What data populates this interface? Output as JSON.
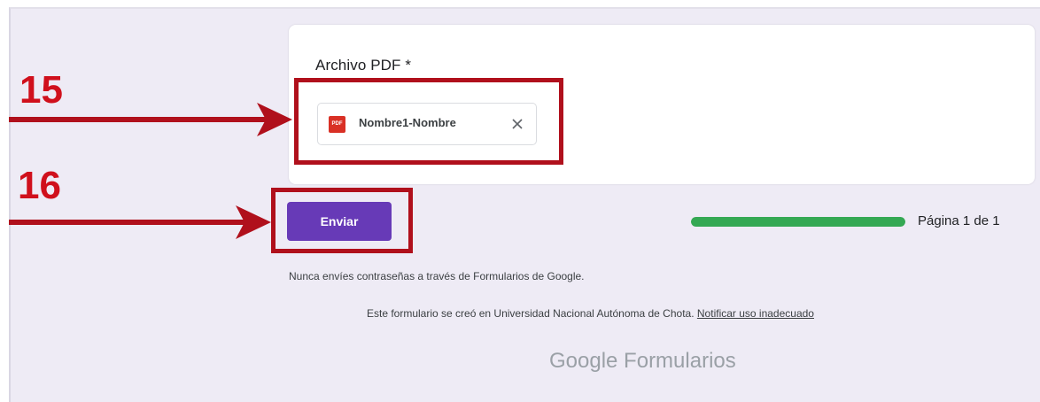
{
  "form": {
    "question_label": "Archivo PDF *",
    "file": {
      "icon_label": "PDF",
      "name": "Nombre1-Nombre",
      "remove_glyph": "✕"
    },
    "submit_label": "Enviar",
    "progress": {
      "fraction": 1.0,
      "label": "Página 1 de 1",
      "color": "#34a853"
    },
    "warning": "Nunca envíes contraseñas a través de Formularios de Google.",
    "footer": {
      "text": "Este formulario se creó en Universidad Nacional Autónoma de Chota.",
      "report_link": "Notificar uso inadecuado"
    },
    "brand": "Google Formularios"
  },
  "annotations": {
    "step_a": "15",
    "step_b": "16",
    "color": "#d0101c"
  },
  "colors": {
    "accent": "#673ab7",
    "background": "#eeebf5"
  }
}
